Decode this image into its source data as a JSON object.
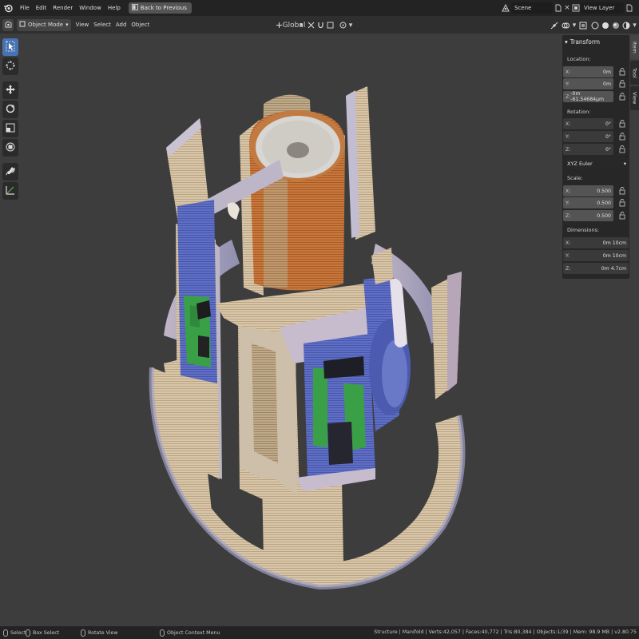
{
  "menu": {
    "items": [
      "File",
      "Edit",
      "Render",
      "Window",
      "Help"
    ],
    "back_button": "Back to Previous",
    "scene": "Scene",
    "view_layer": "View Layer"
  },
  "header": {
    "mode": "Object Mode",
    "menus": [
      "View",
      "Select",
      "Add",
      "Object"
    ],
    "orientation": "Global"
  },
  "sidebar": {
    "panel_title": "Transform",
    "location_label": "Location:",
    "location": [
      {
        "axis": "X:",
        "value": "0m"
      },
      {
        "axis": "Y:",
        "value": "0m"
      },
      {
        "axis": "Z:",
        "value": "-0m -61.54684µm"
      }
    ],
    "rotation_label": "Rotation:",
    "rotation": [
      {
        "axis": "X:",
        "value": "0°"
      },
      {
        "axis": "Y:",
        "value": "0°"
      },
      {
        "axis": "Z:",
        "value": "0°"
      }
    ],
    "rotation_mode": "XYZ Euler",
    "scale_label": "Scale:",
    "scale": [
      {
        "axis": "X:",
        "value": "0.500"
      },
      {
        "axis": "Y:",
        "value": "0.500"
      },
      {
        "axis": "Z:",
        "value": "0.500"
      }
    ],
    "dimensions_label": "Dimensions:",
    "dimensions": [
      {
        "axis": "X:",
        "value": "0m 10cm"
      },
      {
        "axis": "Y:",
        "value": "0m 10cm"
      },
      {
        "axis": "Z:",
        "value": "0m 4.7cm"
      }
    ],
    "tabs": [
      "Item",
      "Tool",
      "View"
    ]
  },
  "status": {
    "select": "Select",
    "box_select": "Box Select",
    "rotate_view": "Rotate View",
    "context_menu": "Object Context Menu",
    "stats": "Structure | Manifold | Verts:42,057 | Faces:40,772 | Tris:80,384 | Objects:1/39 | Mem: 98.9 MB | v2.80.75"
  },
  "colors": {
    "accent": "#4772b3",
    "viewport_bg": "#3d3d3d",
    "model_beige": "#d6c2a4",
    "model_blue": "#5b6fc4",
    "model_copper": "#c8743a",
    "model_green": "#3da34a"
  }
}
